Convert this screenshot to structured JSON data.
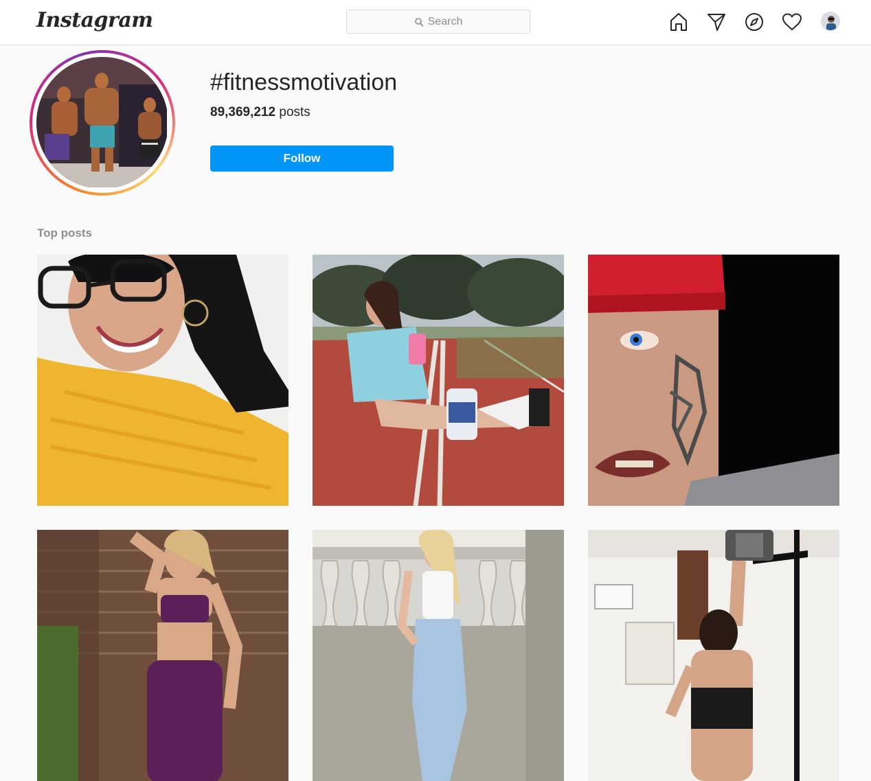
{
  "header": {
    "logo": "Instagram",
    "search_placeholder": "Search",
    "nav_icons": [
      "home-icon",
      "direct-message-icon",
      "explore-icon",
      "activity-heart-icon",
      "profile-avatar"
    ]
  },
  "hashtag": {
    "title": "#fitnessmotivation",
    "post_count": "89,369,212",
    "post_count_suffix": " posts",
    "follow_label": "Follow"
  },
  "section": {
    "top_posts_label": "Top posts"
  },
  "colors": {
    "accent": "#0095f6",
    "border": "#dbdbdb",
    "background": "#fafafa"
  },
  "posts": [
    {
      "subject": "woman-glasses-yellow-top"
    },
    {
      "subject": "woman-running-track-protein"
    },
    {
      "subject": "man-red-cap-face-tattoo"
    },
    {
      "subject": "woman-brick-wall-purple-set"
    },
    {
      "subject": "woman-balustrade-white-top"
    },
    {
      "subject": "woman-gym-dumbbell"
    }
  ]
}
